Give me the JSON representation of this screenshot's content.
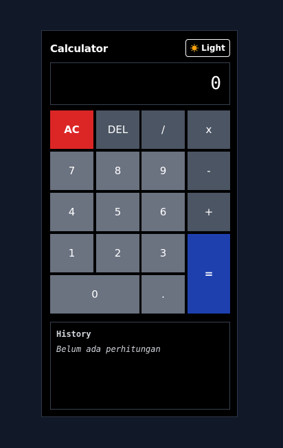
{
  "header": {
    "title": "Calculator",
    "theme_toggle_label": "Light",
    "theme_toggle_icon": "sun-icon"
  },
  "display": {
    "value": "0"
  },
  "keys": {
    "ac": "AC",
    "del": "DEL",
    "divide": "/",
    "multiply": "x",
    "seven": "7",
    "eight": "8",
    "nine": "9",
    "minus": "-",
    "four": "4",
    "five": "5",
    "six": "6",
    "plus": "+",
    "one": "1",
    "two": "2",
    "three": "3",
    "equals": "=",
    "zero": "0",
    "decimal": "."
  },
  "history": {
    "title": "History",
    "empty_text": "Belum ada perhitungan"
  },
  "colors": {
    "page_background": "#111827",
    "card_background": "#000000",
    "number_key": "#6b7280",
    "operator_key": "#4b5563",
    "clear_key": "#dc2626",
    "equals_key": "#1e40af"
  }
}
